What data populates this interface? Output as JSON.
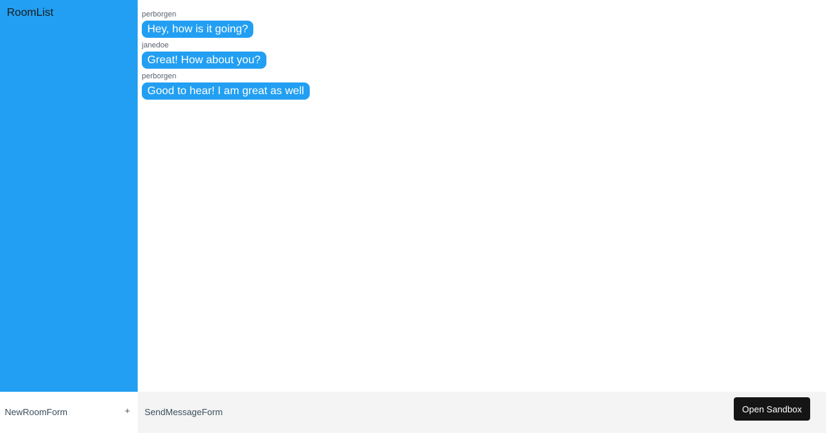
{
  "room_list": {
    "title": "RoomList"
  },
  "messages": [
    {
      "username": "perborgen",
      "text": "Hey, how is it going?"
    },
    {
      "username": "janedoe",
      "text": "Great! How about you?"
    },
    {
      "username": "perborgen",
      "text": "Good to hear! I am great as well"
    }
  ],
  "new_room_form": {
    "label": "NewRoomForm",
    "add_icon": "+"
  },
  "send_message_form": {
    "label": "SendMessageForm"
  },
  "sandbox": {
    "button_label": "Open Sandbox"
  },
  "colors": {
    "accent": "#229ff2",
    "button_dark": "#151515",
    "form_bg": "#f4f4f4"
  }
}
